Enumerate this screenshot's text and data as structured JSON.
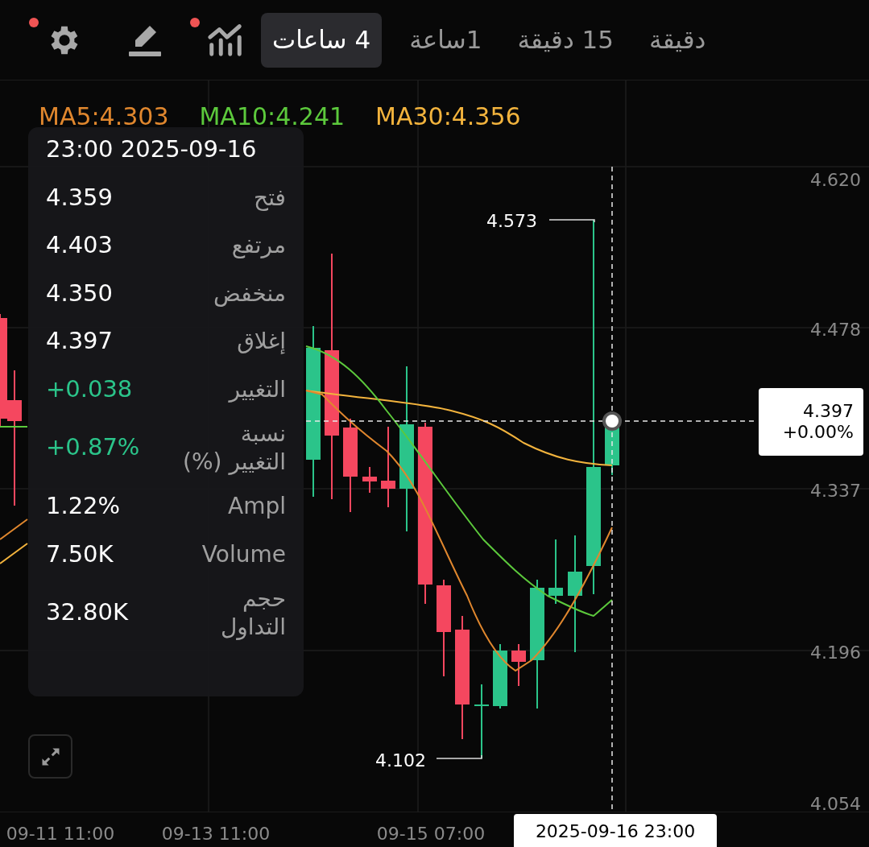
{
  "toolbar": {
    "tabs": [
      {
        "label": "دقيقة",
        "selected": false
      },
      {
        "label": "15 دقيقة",
        "selected": false
      },
      {
        "label": "1ساعة",
        "selected": false
      },
      {
        "label": "4 ساعات",
        "selected": true
      }
    ],
    "icons": [
      {
        "kind": "indicators",
        "badge": true
      },
      {
        "kind": "draw",
        "badge": false
      },
      {
        "kind": "settings",
        "badge": true
      }
    ]
  },
  "ma_legend": [
    {
      "label": "MA30:4.356",
      "color": "#f2b33d"
    },
    {
      "label": "MA10:4.241",
      "color": "#5cc93c"
    },
    {
      "label": "MA5:4.303",
      "color": "#e0872e"
    }
  ],
  "tooltip": {
    "date": "23:00 2025-09-16",
    "rows": [
      {
        "label": "فتح",
        "value": "4.359",
        "color": "#ffffff"
      },
      {
        "label": "مرتفع",
        "value": "4.403",
        "color": "#ffffff"
      },
      {
        "label": "منخفض",
        "value": "4.350",
        "color": "#ffffff"
      },
      {
        "label": "إغلاق",
        "value": "4.397",
        "color": "#ffffff"
      },
      {
        "label": "التغيير",
        "value": "+0.038",
        "color": "#2bc48a"
      },
      {
        "label": "نسبة التغيير (%)",
        "value": "+0.87%",
        "color": "#2bc48a"
      },
      {
        "label": "Ampl",
        "value": "1.22%",
        "color": "#ffffff"
      },
      {
        "label": "Volume",
        "value": "7.50K",
        "color": "#ffffff"
      },
      {
        "label": "حجم التداول",
        "value": "32.80K",
        "color": "#ffffff"
      }
    ]
  },
  "y_axis": [
    "4.620",
    "4.478",
    "4.337",
    "4.196",
    "4.054"
  ],
  "markers": {
    "high": "4.573",
    "low": "4.102"
  },
  "crosshair": {
    "price": "4.397",
    "change": "+0.00%",
    "time": "2025-09-16 23:00"
  },
  "x_axis": [
    "09-15 07:00",
    "09-13 11:00",
    "09-11 11:00"
  ]
}
